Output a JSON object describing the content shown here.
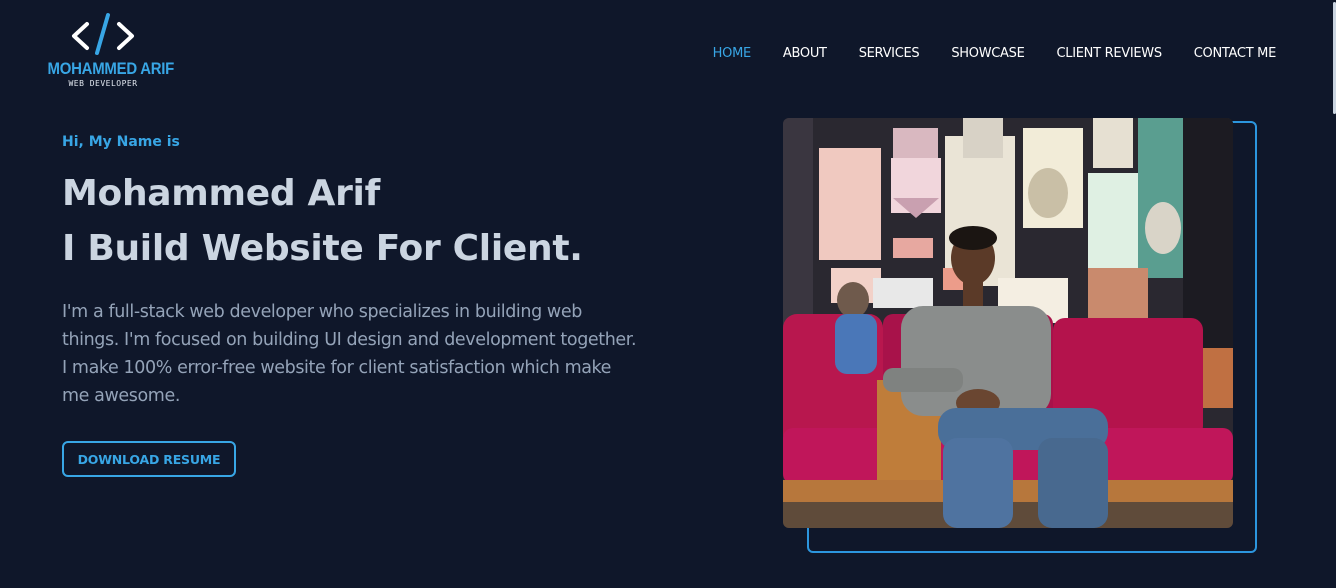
{
  "logo": {
    "name": "MOHAMMED ARIF",
    "subtitle": "WEB DEVELOPER",
    "icon": "code-brackets-icon"
  },
  "nav": {
    "items": [
      {
        "label": "HOME",
        "active": true
      },
      {
        "label": "ABOUT",
        "active": false
      },
      {
        "label": "SERVICES",
        "active": false
      },
      {
        "label": "SHOWCASE",
        "active": false
      },
      {
        "label": "CLIENT REVIEWS",
        "active": false
      },
      {
        "label": "CONTACT ME",
        "active": false
      }
    ]
  },
  "hero": {
    "greeting": "Hi, My Name is",
    "title_line1": "Mohammed Arif",
    "title_line2": "I Build Website For Client.",
    "description": "I'm a full-stack web developer who specializes in building web things. I'm focused on building UI design and development together. I make 100% error-free website for client satisfaction which make me awesome.",
    "button_label": "DOWNLOAD RESUME"
  },
  "colors": {
    "background": "#0f172a",
    "accent": "#38a6e5",
    "heading": "#cbd5e1",
    "text": "#94a3b8"
  }
}
